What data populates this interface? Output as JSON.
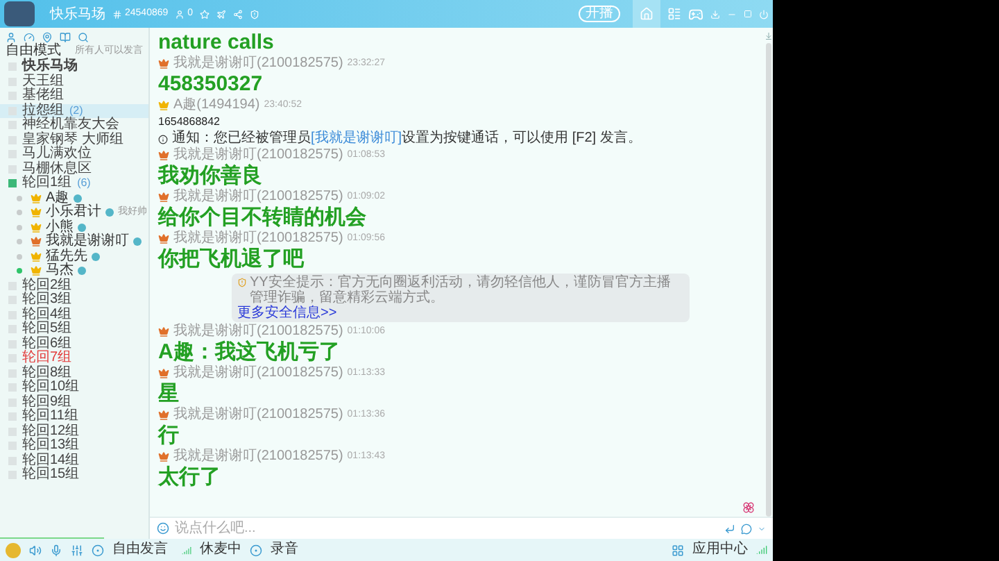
{
  "window": {
    "channel_name": "快乐马场",
    "channel_id": "24540869",
    "online_count": "0",
    "live_button": "开播"
  },
  "sidebar": {
    "mode": "自由模式",
    "mode_hint": "所有人可以发言",
    "channels": [
      {
        "kind": "root",
        "name": "快乐马场",
        "expanded": false,
        "selected": false,
        "alert": false
      },
      {
        "kind": "channel",
        "name": "天王组",
        "expanded": false,
        "selected": false,
        "alert": false
      },
      {
        "kind": "channel",
        "name": "基佬组",
        "expanded": false,
        "selected": false,
        "alert": false
      },
      {
        "kind": "channel",
        "name": "拉怨组",
        "count": "(2)",
        "expanded": false,
        "selected": true,
        "alert": false
      },
      {
        "kind": "channel",
        "name": "神经机靠友大会",
        "expanded": false,
        "selected": false,
        "alert": false
      },
      {
        "kind": "channel",
        "name": "皇家钢琴 大师组",
        "expanded": false,
        "selected": false,
        "alert": false
      },
      {
        "kind": "channel",
        "name": "马儿满欢位",
        "expanded": false,
        "selected": false,
        "alert": false
      },
      {
        "kind": "channel",
        "name": "马棚休息区",
        "expanded": false,
        "selected": false,
        "alert": false
      },
      {
        "kind": "channel",
        "name": "轮回1组",
        "count": "(6)",
        "expanded": true,
        "selected": false,
        "alert": false,
        "children": [
          {
            "name": "A趣",
            "color": "#f0b400",
            "active": false
          },
          {
            "name": "小乐君计",
            "color": "#f0b400",
            "active": false,
            "note": "我好帅"
          },
          {
            "name": "小熊",
            "color": "#f0b400",
            "active": false
          },
          {
            "name": "我就是谢谢叮",
            "color": "#e0702a",
            "active": false
          },
          {
            "name": "猛先先",
            "color": "#f0b400",
            "active": false
          },
          {
            "name": "马杰",
            "color": "#f0b400",
            "active": true
          }
        ]
      },
      {
        "kind": "channel",
        "name": "轮回2组",
        "expanded": false,
        "selected": false,
        "alert": false
      },
      {
        "kind": "channel",
        "name": "轮回3组",
        "expanded": false,
        "selected": false,
        "alert": false
      },
      {
        "kind": "channel",
        "name": "轮回4组",
        "expanded": false,
        "selected": false,
        "alert": false
      },
      {
        "kind": "channel",
        "name": "轮回5组",
        "expanded": false,
        "selected": false,
        "alert": false
      },
      {
        "kind": "channel",
        "name": "轮回6组",
        "expanded": false,
        "selected": false,
        "alert": false
      },
      {
        "kind": "channel",
        "name": "轮回7组",
        "expanded": false,
        "selected": false,
        "alert": true
      },
      {
        "kind": "channel",
        "name": "轮回8组",
        "expanded": false,
        "selected": false,
        "alert": false
      },
      {
        "kind": "channel",
        "name": "轮回10组",
        "expanded": false,
        "selected": false,
        "alert": false
      },
      {
        "kind": "channel",
        "name": "轮回9组",
        "expanded": false,
        "selected": false,
        "alert": false
      },
      {
        "kind": "channel",
        "name": "轮回11组",
        "expanded": false,
        "selected": false,
        "alert": false
      },
      {
        "kind": "channel",
        "name": "轮回12组",
        "expanded": false,
        "selected": false,
        "alert": false
      },
      {
        "kind": "channel",
        "name": "轮回13组",
        "expanded": false,
        "selected": false,
        "alert": false
      },
      {
        "kind": "channel",
        "name": "轮回14组",
        "expanded": false,
        "selected": false,
        "alert": false
      },
      {
        "kind": "channel",
        "name": "轮回15组",
        "expanded": false,
        "selected": false,
        "alert": false
      }
    ]
  },
  "chat": {
    "messages": [
      {
        "kind": "big",
        "text": "nature calls"
      },
      {
        "kind": "sender",
        "color": "#e0702a",
        "name": "我就是谢谢叮(2100182575)",
        "time": "23:32:27"
      },
      {
        "kind": "big",
        "text": "458350327"
      },
      {
        "kind": "sender",
        "color": "#f0b400",
        "name": "A趣(1494194)",
        "time": "23:40:52"
      },
      {
        "kind": "small",
        "text": "1654868842"
      },
      {
        "kind": "notice",
        "before": "通知：您已经被管理员",
        "link": "[我就是谢谢叮]",
        "after": "设置为按键通话，可以使用 [F2] 发言。"
      },
      {
        "kind": "sender",
        "color": "#e0702a",
        "name": "我就是谢谢叮(2100182575)",
        "time": "01:08:53"
      },
      {
        "kind": "big",
        "text": "我劝你善良"
      },
      {
        "kind": "sender",
        "color": "#e0702a",
        "name": "我就是谢谢叮(2100182575)",
        "time": "01:09:02"
      },
      {
        "kind": "big",
        "text": "给你个目不转睛的机会"
      },
      {
        "kind": "sender",
        "color": "#e0702a",
        "name": "我就是谢谢叮(2100182575)",
        "time": "01:09:56"
      },
      {
        "kind": "big",
        "text": "你把飞机退了吧"
      },
      {
        "kind": "tip",
        "text": "YY安全提示：官方无向圈返利活动，请勿轻信他人，谨防冒官方主播管理诈骗，留意精彩云端方式。",
        "link": "更多安全信息>>"
      },
      {
        "kind": "sender",
        "color": "#e0702a",
        "name": "我就是谢谢叮(2100182575)",
        "time": "01:10:06"
      },
      {
        "kind": "big",
        "text": "A趣：我这飞机亏了"
      },
      {
        "kind": "sender",
        "color": "#e0702a",
        "name": "我就是谢谢叮(2100182575)",
        "time": "01:13:33"
      },
      {
        "kind": "big",
        "text": "星"
      },
      {
        "kind": "sender",
        "color": "#e0702a",
        "name": "我就是谢谢叮(2100182575)",
        "time": "01:13:36"
      },
      {
        "kind": "big",
        "text": "行"
      },
      {
        "kind": "sender",
        "color": "#e0702a",
        "name": "我就是谢谢叮(2100182575)",
        "time": "01:13:43"
      },
      {
        "kind": "big",
        "text": "太行了"
      }
    ],
    "input_placeholder": "说点什么吧..."
  },
  "toolbar": {
    "speak_mode": "自由发言",
    "mic_status": "休麦中",
    "record": "录音",
    "app_center": "应用中心"
  }
}
